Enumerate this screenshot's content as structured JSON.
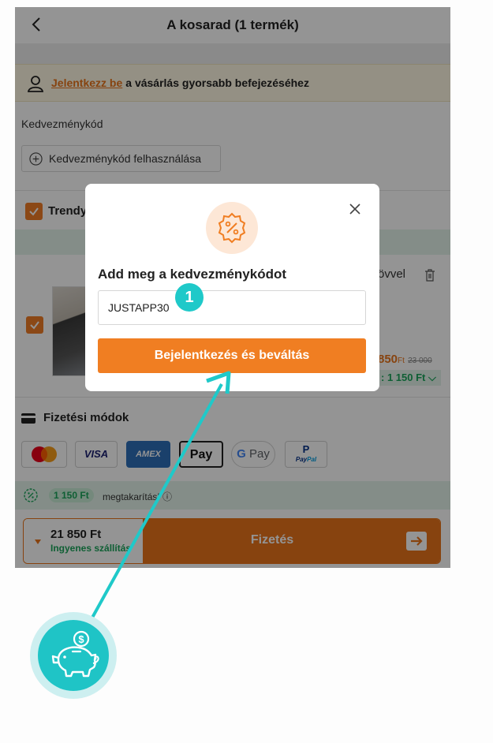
{
  "header": {
    "title": "A kosarad (1 termék)",
    "back_icon": "chevron-left-icon"
  },
  "login_banner": {
    "link": "Jelentkezz be",
    "text": "a vásárlás gyorsabb befejezéséhez",
    "icon": "user-icon"
  },
  "coupon": {
    "label": "Kedvezménykód",
    "button": "Kedvezménykód felhasználása",
    "icon": "plus-circle-icon"
  },
  "store": {
    "name": "Trendy"
  },
  "product": {
    "title_fragment": "övvel",
    "price": "850",
    "price_unit": "Ft",
    "old_price": "23 000",
    "savings": "1 150 Ft"
  },
  "payment": {
    "label": "Fizetési módok",
    "methods": [
      "Mastercard",
      "VISA",
      "AMEX",
      "Apple Pay",
      "Google Pay",
      "PayPal"
    ],
    "visa": "VISA",
    "amex": "AMEX",
    "applepay": "Pay",
    "gpay": "Pay",
    "paypal_pay": "Pay",
    "paypal_pal": "Pal"
  },
  "savings_bar": {
    "amount": "1 150 Ft",
    "text": "megtakarítás!"
  },
  "bottom_bar": {
    "total": "21 850 Ft",
    "shipping": "Ingyenes szállítás",
    "checkout": "Fizetés"
  },
  "modal": {
    "title": "Add meg a kedvezménykódot",
    "input_value": "JUSTAPP30",
    "submit": "Bejelentkezés és beváltás",
    "icon": "percent-badge-icon",
    "close_icon": "close-icon"
  },
  "annotation": {
    "step": "1",
    "pointer_color": "#1fc9c9",
    "mascot_icon": "piggy-bank-icon"
  },
  "colors": {
    "accent": "#e8741b",
    "green": "#1aa45b",
    "teal": "#1fc4c6"
  }
}
